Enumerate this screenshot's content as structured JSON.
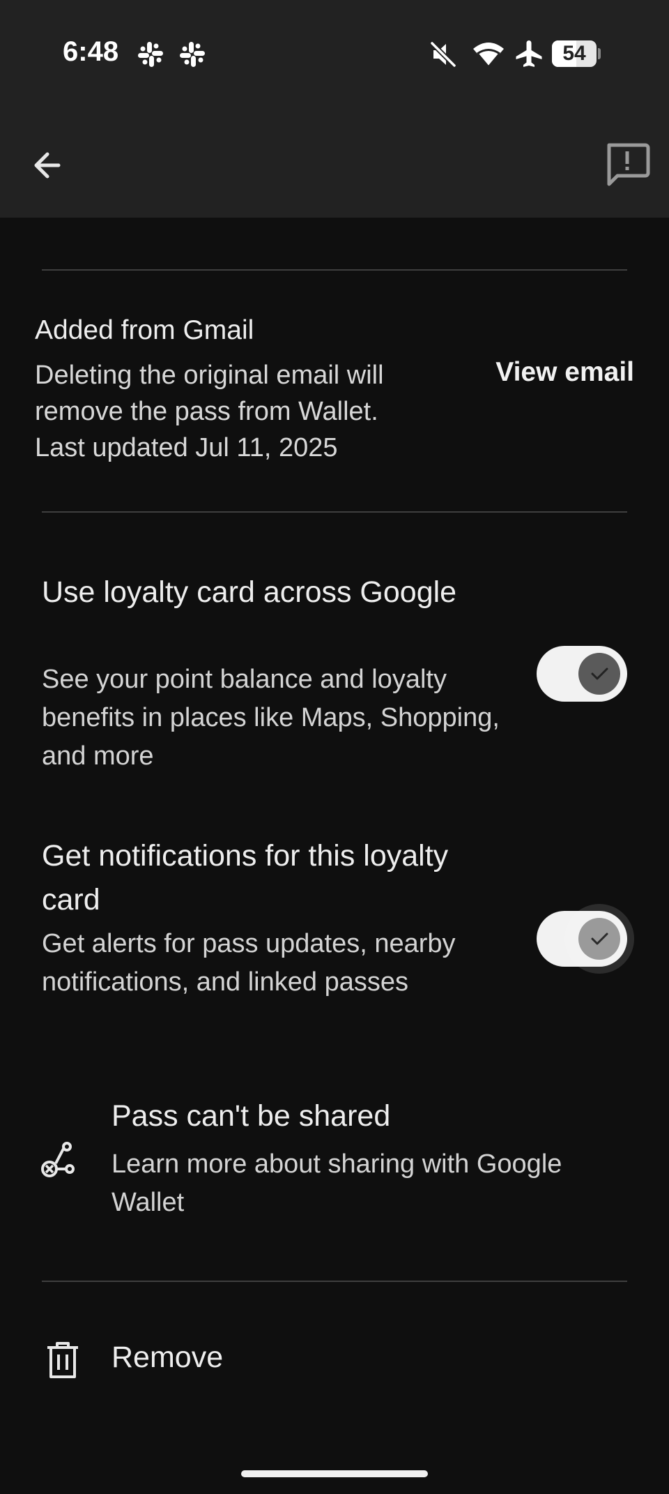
{
  "status_bar": {
    "time": "6:48",
    "battery_level": "54",
    "battery_fraction": 0.54,
    "icons": [
      "slack-icon",
      "slack-icon",
      "mute-icon",
      "wifi-icon",
      "airplane-icon",
      "battery-icon"
    ]
  },
  "toolbar": {
    "back_icon": "arrow-left-icon",
    "feedback_icon": "feedback-icon"
  },
  "source": {
    "title": "Added from Gmail",
    "description": "Deleting the original email will remove the pass from Wallet.",
    "last_updated": "Last updated Jul 11, 2025",
    "action_label": "View email"
  },
  "settings": [
    {
      "title": "Use loyalty card across Google",
      "description": "See your point balance and loyalty benefits in places like Maps, Shopping, and more",
      "enabled": true
    },
    {
      "title": "Get notifications for this loyalty card",
      "description": "Get alerts for pass updates, nearby notifications, and linked passes",
      "enabled": true
    }
  ],
  "sharing": {
    "title": "Pass can't be shared",
    "description": "Learn more about sharing with Google Wallet",
    "icon": "share-off-icon"
  },
  "remove": {
    "label": "Remove",
    "icon": "trash-icon"
  },
  "colors": {
    "background": "#0f0f0f",
    "header": "#222222",
    "toggle_track": "#f2f2f2",
    "toggle_thumb_1": "#5a5a5a",
    "toggle_thumb_2": "#9a9a9a"
  }
}
